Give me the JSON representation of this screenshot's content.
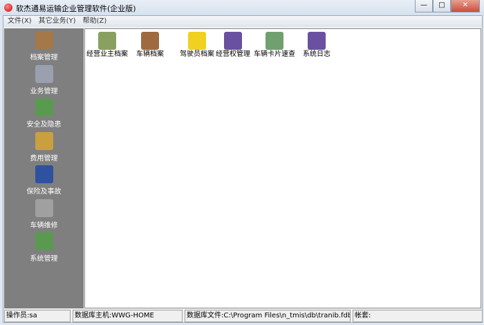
{
  "window": {
    "title": "软杰通易运输企业管理软件(企业版)",
    "minimize": "—",
    "maximize": "□",
    "close": "✕"
  },
  "menu": [
    "文件(X)",
    "其它业务(Y)",
    "帮助(Z)"
  ],
  "sidebar": [
    {
      "label": "档案管理",
      "icon": "folders-icon",
      "color": "#a5784a"
    },
    {
      "label": "业务管理",
      "icon": "cards-icon",
      "color": "#9aa0b0"
    },
    {
      "label": "安全及隐患",
      "icon": "box-icon",
      "color": "#5a9a50"
    },
    {
      "label": "费用管理",
      "icon": "money-bag-icon",
      "color": "#c9a040"
    },
    {
      "label": "保险及事故",
      "icon": "monitor-icon",
      "color": "#3050a0"
    },
    {
      "label": "车辆维修",
      "icon": "wrench-icon",
      "color": "#a0a0a0"
    },
    {
      "label": "系统管理",
      "icon": "box-icon",
      "color": "#5a9a50"
    }
  ],
  "content": [
    {
      "label": "经营业主档案",
      "icon": "owner-file-icon",
      "color": "#8aa060"
    },
    {
      "label": "车辆档案",
      "icon": "truck-icon",
      "color": "#a06a40"
    },
    {
      "label": "驾驶员档案",
      "icon": "driver-icon",
      "color": "#f0d020"
    },
    {
      "label": "经营权管理",
      "icon": "chart-icon",
      "color": "#6a50a0"
    },
    {
      "label": "车辆卡片速查",
      "icon": "magnifier-icon",
      "color": "#70a070"
    },
    {
      "label": "系统日志",
      "icon": "chart-icon",
      "color": "#6a50a0"
    }
  ],
  "status": {
    "operator": "操作员:sa",
    "host": "数据库主机:WWG-HOME",
    "dbfile": "数据库文件:C:\\Program Files\\n_tmis\\db\\tranib.fdb",
    "account": "帐套:"
  }
}
